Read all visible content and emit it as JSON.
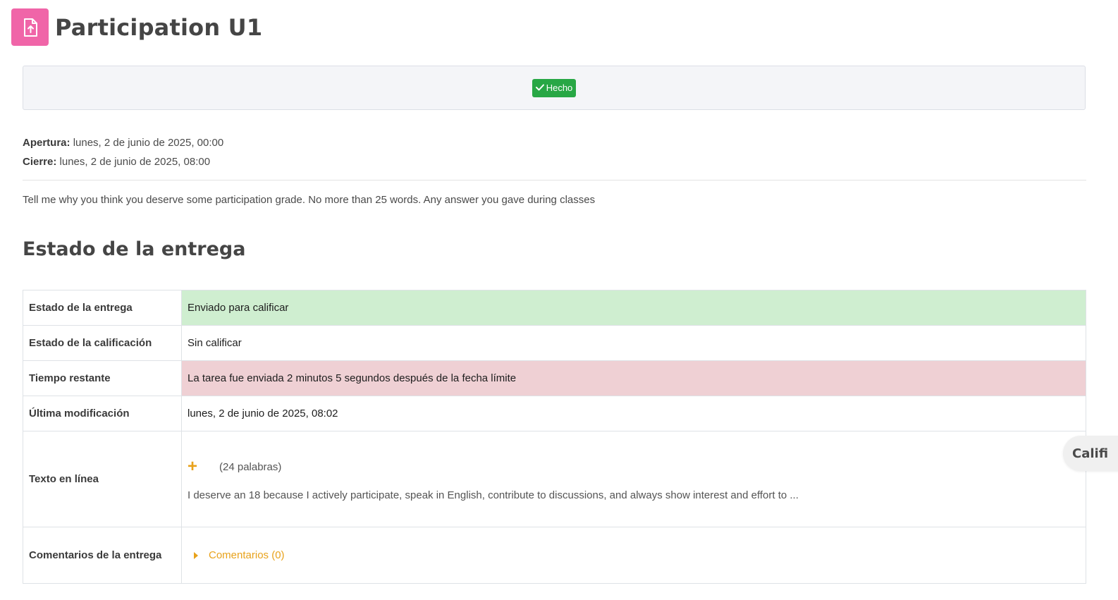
{
  "page": {
    "title": "Participation U1",
    "activity_icon": "file-upload-icon",
    "accent_color": "#f065a8"
  },
  "completion": {
    "label": "Hecho",
    "icon": "check-icon",
    "color": "#28a745"
  },
  "dates": {
    "opening_label": "Apertura:",
    "opening_value": "lunes, 2 de junio de 2025, 00:00",
    "closing_label": "Cierre:",
    "closing_value": "lunes, 2 de junio de 2025, 08:00"
  },
  "intro": "Tell me why you think you deserve some participation grade. No more than 25 words. Any answer you gave during classes",
  "submission_status": {
    "heading": "Estado de la entrega",
    "rows": [
      {
        "label": "Estado de la entrega",
        "value": "Enviado para calificar"
      },
      {
        "label": "Estado de la calificación",
        "value": "Sin calificar"
      },
      {
        "label": "Tiempo restante",
        "value": "La tarea fue enviada 2 minutos 5 segundos después de la fecha límite"
      },
      {
        "label": "Última modificación",
        "value": "lunes, 2 de junio de 2025, 08:02"
      },
      {
        "label": "Texto en línea",
        "word_count": "(24 palabras)",
        "preview": "I deserve an 18 because I actively participate, speak in English, contribute to discussions, and always show interest and effort to ..."
      },
      {
        "label": "Comentarios de la entrega",
        "comments_link": "Comentarios (0)"
      }
    ]
  },
  "side_tab": {
    "label": "Califi"
  }
}
